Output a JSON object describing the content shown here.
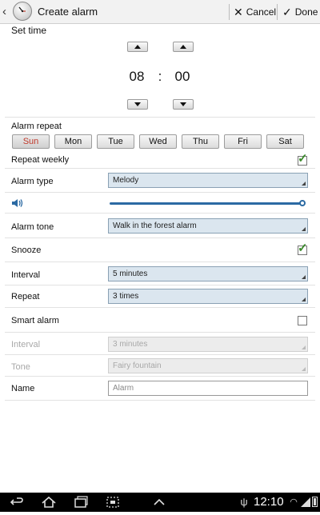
{
  "header": {
    "title": "Create alarm",
    "cancel_label": "Cancel",
    "done_label": "Done"
  },
  "time": {
    "section_label": "Set time",
    "hour": "08",
    "separator": ":",
    "minute": "00"
  },
  "repeat": {
    "section_label": "Alarm repeat",
    "days": [
      {
        "label": "Sun",
        "selected": true
      },
      {
        "label": "Mon",
        "selected": false
      },
      {
        "label": "Tue",
        "selected": false
      },
      {
        "label": "Wed",
        "selected": false
      },
      {
        "label": "Thu",
        "selected": false
      },
      {
        "label": "Fri",
        "selected": false
      },
      {
        "label": "Sat",
        "selected": false
      }
    ],
    "weekly_label": "Repeat weekly",
    "weekly_checked": true
  },
  "alarm_type": {
    "label": "Alarm type",
    "value": "Melody"
  },
  "volume": {
    "icon": "speaker-icon",
    "level": 1.0
  },
  "alarm_tone": {
    "label": "Alarm tone",
    "value": "Walk in the forest alarm"
  },
  "snooze": {
    "label": "Snooze",
    "checked": true,
    "interval_label": "Interval",
    "interval_value": "5 minutes",
    "repeat_label": "Repeat",
    "repeat_value": "3 times"
  },
  "smart_alarm": {
    "label": "Smart alarm",
    "checked": false,
    "interval_label": "Interval",
    "interval_value": "3 minutes",
    "tone_label": "Tone",
    "tone_value": "Fairy fountain"
  },
  "name": {
    "label": "Name",
    "placeholder": "Alarm"
  },
  "status_bar": {
    "time": "12:10"
  },
  "colors": {
    "accent": "#2b6aa3",
    "selected_day": "#c0392b",
    "check": "#3a8a2a"
  }
}
